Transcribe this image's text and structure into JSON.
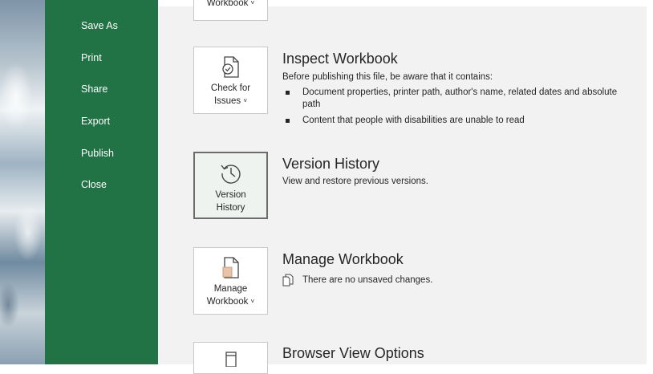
{
  "sidebar": {
    "items": [
      {
        "label": "Save As"
      },
      {
        "label": "Print"
      },
      {
        "label": "Share"
      },
      {
        "label": "Export"
      },
      {
        "label": "Publish"
      },
      {
        "label": "Close"
      }
    ]
  },
  "sections": {
    "top_partial": {
      "tile_label": "Workbook",
      "chevron": "˅"
    },
    "inspect": {
      "tile_label_line1": "Check for",
      "tile_label_line2": "Issues",
      "chevron": "˅",
      "title": "Inspect Workbook",
      "description": "Before publishing this file, be aware that it contains:",
      "bullets": [
        "Document properties, printer path, author's name, related dates and absolute path",
        "Content that people with disabilities are unable to read"
      ]
    },
    "version": {
      "tile_label_line1": "Version",
      "tile_label_line2": "History",
      "title": "Version History",
      "description": "View and restore previous versions."
    },
    "manage": {
      "tile_label_line1": "Manage",
      "tile_label_line2": "Workbook",
      "chevron": "˅",
      "title": "Manage Workbook",
      "status": "There are no unsaved changes."
    },
    "browser": {
      "title": "Browser View Options"
    }
  },
  "colors": {
    "sidebar_green": "#217346",
    "main_bg": "#f2f2f2"
  }
}
